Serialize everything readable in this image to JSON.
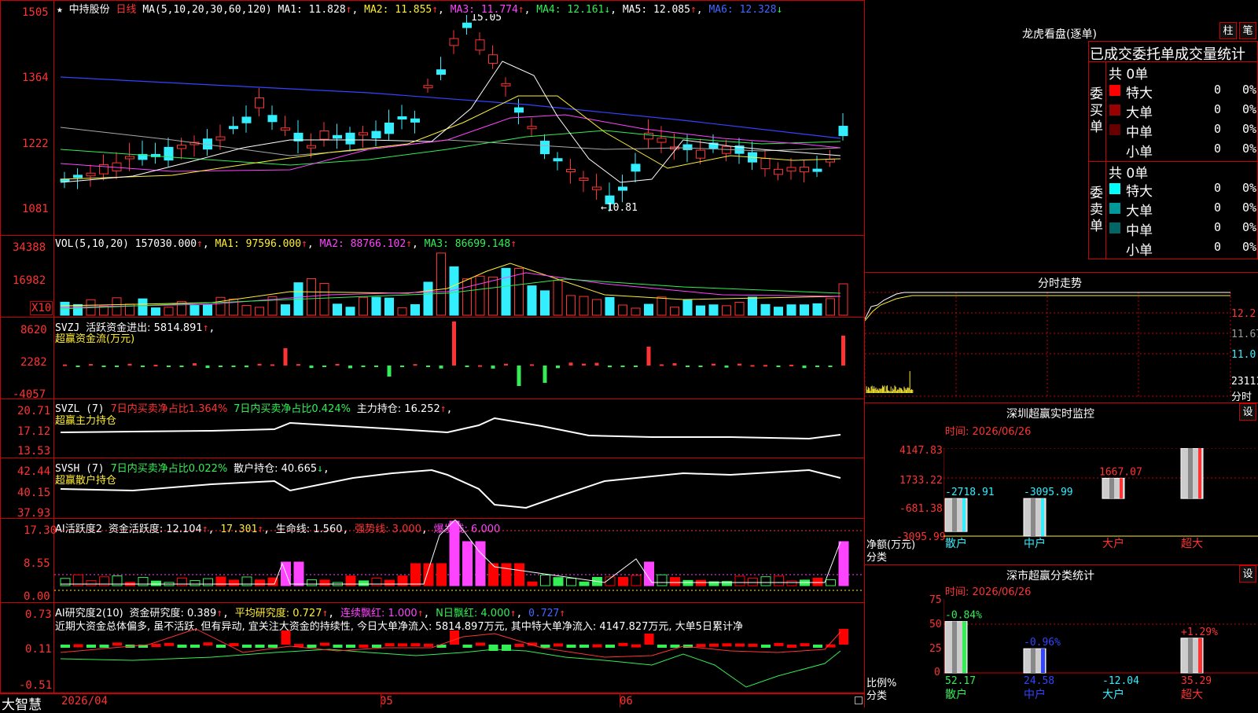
{
  "stock": {
    "title_icon": "star-icon",
    "name": "中持股份",
    "period": "日线"
  },
  "ma_bar": {
    "label": "MA(5,10,20,30,60,120)",
    "ma1": "MA1: 11.828",
    "ma2": "MA2: 11.855",
    "ma3": "MA3: 11.774",
    "ma4": "MA4: 12.161",
    "ma5": "MA5: 12.085",
    "ma6": "MA6: 12.328",
    "ma1_dir": "↑",
    "ma2_dir": "↑",
    "ma3_dir": "↑",
    "ma4_dir": "↓",
    "ma5_dir": "↑",
    "ma6_dir": "↓"
  },
  "price_axis": [
    "1505",
    "1364",
    "1222",
    "1081"
  ],
  "price_high": "15.05",
  "price_low": "←10.81",
  "vol_bar": {
    "label": "VOL(5,10,20)",
    "v": "157030.000",
    "ma1": "MA1: 97596.000",
    "ma2": "MA2: 88766.102",
    "ma3": "MA3: 86699.148",
    "dir": "↑"
  },
  "vol_axis": [
    "34388",
    "16982"
  ],
  "vol_unit": "X10",
  "svzj": {
    "label": "SVZJ",
    "t1": "活跃资金进出: 5814.891",
    "t1_dir": "↑",
    "comma": ",",
    "t2": "超赢资金流(万元)",
    "axis": [
      "8620",
      "2282",
      "-4057"
    ]
  },
  "svzl": {
    "label": "SVZL (7)",
    "t1": "7日内买卖净占比1.364%",
    "t2": "7日内买卖净占比0.424%",
    "t3": "主力持仓: 16.252",
    "t3_dir": "↑",
    "comma": ",",
    "t4": "超赢主力持仓",
    "axis": [
      "20.71",
      "17.12",
      "13.53"
    ]
  },
  "svsh": {
    "label": "SVSH (7)",
    "t1": "7日内买卖净占比0.022%",
    "t2": "散户持仓: 40.665",
    "t2_dir": "↓",
    "comma": ",",
    "t3": "超赢散户持仓",
    "axis": [
      "42.44",
      "40.15",
      "37.93"
    ]
  },
  "ai2": {
    "label": "AI活跃度2",
    "t1": "资金活跃度: 12.104",
    "t2": "17.301",
    "t3": "生命线: 1.560",
    "t4": "强势线: 3.000",
    "t5": "爆发线: 6.000",
    "dir": "↑",
    "comma": ",",
    "axis": [
      "17.30",
      "8.55",
      "0.00"
    ]
  },
  "ai_res": {
    "label": "AI研究度2(10)",
    "t1": "资金研究度: 0.389",
    "t2": "平均研究度: 0.727",
    "t3": "连续飘红: 1.000",
    "t4": "N日飘红: 4.000",
    "t5": "0.727",
    "dir": "↑",
    "comma": ",",
    "desc": "近期大资金总体偏多, 虽不活跃, 但有异动, 宜关注大资金的持续性, 今日大单净流入: 5814.897万元, 其中特大单净流入: 4147.827万元, 大单5日累计净",
    "axis": [
      "0.73",
      "0.11",
      "-0.51"
    ]
  },
  "time_axis": {
    "d1": "2026/04",
    "d2": "05",
    "d3": "06"
  },
  "brand": "大智慧",
  "rp": {
    "title": "龙虎看盘(逐单)",
    "btn1": "柱",
    "btn2": "笔",
    "header": "已成交委托单成交量统计",
    "buy": {
      "side": "委买单",
      "total": "共 0单",
      "rows": [
        {
          "label": "特大",
          "v": "0",
          "p": "0%",
          "color": "#ff0000"
        },
        {
          "label": "大单",
          "v": "0",
          "p": "0%",
          "color": "#990000"
        },
        {
          "label": "中单",
          "v": "0",
          "p": "0%",
          "color": "#660000"
        },
        {
          "label": "小单",
          "v": "0",
          "p": "0%",
          "color": "#000000"
        }
      ]
    },
    "sell": {
      "side": "委卖单",
      "total": "共 0单",
      "rows": [
        {
          "label": "特大",
          "v": "0",
          "p": "0%",
          "color": "#00ffff"
        },
        {
          "label": "大单",
          "v": "0",
          "p": "0%",
          "color": "#009999"
        },
        {
          "label": "中单",
          "v": "0",
          "p": "0%",
          "color": "#006666"
        },
        {
          "label": "小单",
          "v": "0",
          "p": "0%",
          "color": "#000000"
        }
      ]
    }
  },
  "fenshi": {
    "title": "分时走势",
    "axis": [
      "12.2",
      "11.67",
      "11.0",
      "23111",
      "分时"
    ]
  },
  "sz_monitor": {
    "title": "深圳超赢实时监控",
    "btn": "设",
    "time": "时间: 2026/06/26",
    "axis": [
      "4147.83",
      "1733.22",
      "-681.38",
      "-3095.99"
    ],
    "unit": "净额(万元)",
    "cat_label": "分类",
    "bars": [
      {
        "cat": "散户",
        "v": "-2718.91",
        "value": -2718.91
      },
      {
        "cat": "中户",
        "v": "-3095.99",
        "value": -3095.99
      },
      {
        "cat": "大户",
        "v": "1667.07",
        "value": 1667.07
      },
      {
        "cat": "超大",
        "v": "4147.83",
        "value": 4147.83
      }
    ]
  },
  "sz_class": {
    "title": "深市超赢分类统计",
    "btn": "设",
    "time": "时间: 2026/06/26",
    "axis": [
      "75",
      "50",
      "25",
      "0"
    ],
    "unit": "比例%",
    "cat_label": "分类",
    "bars": [
      {
        "cat": "散户",
        "top": "-0.84%",
        "bottom": "52.17",
        "value": 52.17,
        "color": "#33ee55"
      },
      {
        "cat": "中户",
        "top": "-0.96%",
        "bottom": "24.58",
        "value": 24.58,
        "color": "#3344ff"
      },
      {
        "cat": "大户",
        "top": "",
        "bottom": "-12.04",
        "value": 0,
        "color": "#33eeff"
      },
      {
        "cat": "超大",
        "top": "+1.29%",
        "bottom": "35.29",
        "value": 35.29,
        "color": "#ff3333"
      }
    ]
  }
}
